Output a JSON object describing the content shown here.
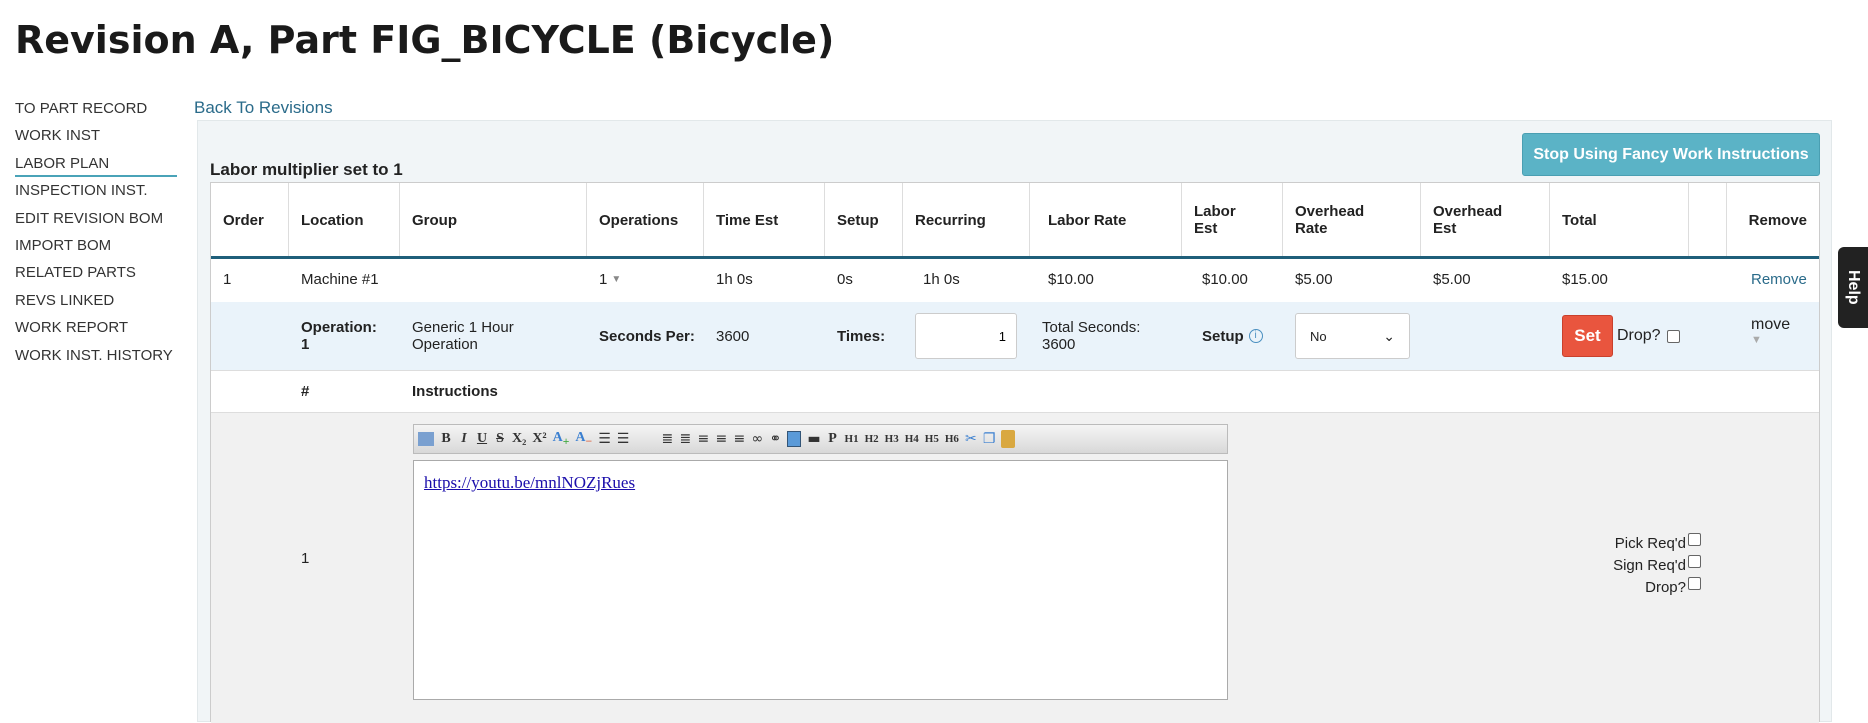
{
  "title": "Revision A, Part FIG_BICYCLE (Bicycle)",
  "sidebar": {
    "items": [
      {
        "label": "TO PART RECORD"
      },
      {
        "label": "WORK INST"
      },
      {
        "label": "LABOR PLAN"
      },
      {
        "label": "INSPECTION INST."
      },
      {
        "label": "EDIT REVISION BOM"
      },
      {
        "label": "IMPORT BOM"
      },
      {
        "label": "RELATED PARTS"
      },
      {
        "label": "REVS LINKED"
      },
      {
        "label": "WORK REPORT"
      },
      {
        "label": "WORK INST. HISTORY"
      }
    ],
    "active": "LABOR PLAN"
  },
  "back_link": "Back To Revisions",
  "fancy_button": "Stop Using Fancy Work Instructions",
  "multiplier_text": "Labor multiplier set to 1",
  "table": {
    "headers": [
      "Order",
      "Location",
      "Group",
      "Operations",
      "Time Est",
      "Setup",
      "Recurring",
      "Labor Rate",
      "Labor Est",
      "Overhead Rate",
      "Overhead Est",
      "Total",
      "",
      "Remove"
    ],
    "row": {
      "order": "1",
      "location": "Machine #1",
      "group": "",
      "operations": "1",
      "time_est": "1h 0s",
      "setup": "0s",
      "recurring": "1h 0s",
      "labor_rate": "$10.00",
      "labor_est": "$10.00",
      "overhead_rate": "$5.00",
      "overhead_est": "$5.00",
      "total": "$15.00",
      "remove": "Remove"
    },
    "operation": {
      "label": "Operation: 1",
      "name": "Generic 1 Hour Operation",
      "seconds_per_label": "Seconds Per:",
      "seconds_per": "3600",
      "times_label": "Times:",
      "times_value": "1",
      "total_seconds": "Total Seconds: 3600",
      "setup_label": "Setup",
      "setup_select": "No",
      "set_button": "Set",
      "drop_label": "Drop?",
      "move_label": "move"
    },
    "instructions": {
      "headers": [
        "#",
        "Instructions"
      ],
      "rows": [
        {
          "num": "1",
          "content": "https://youtu.be/mnlNOZjRues",
          "pick": "Pick Req'd",
          "sign": "Sign Req'd",
          "drop": "Drop?"
        }
      ]
    },
    "toolbar": [
      "B",
      "I",
      "U",
      "S",
      "X₂",
      "X²",
      "P",
      "H1",
      "H2",
      "H3",
      "H4",
      "H5",
      "H6"
    ]
  },
  "help_tab": "Help",
  "colors": {
    "accent": "#5bb3c6",
    "set_button": "#e9553e",
    "link": "#2a6b8a",
    "header_rule": "#1f5f7a"
  }
}
